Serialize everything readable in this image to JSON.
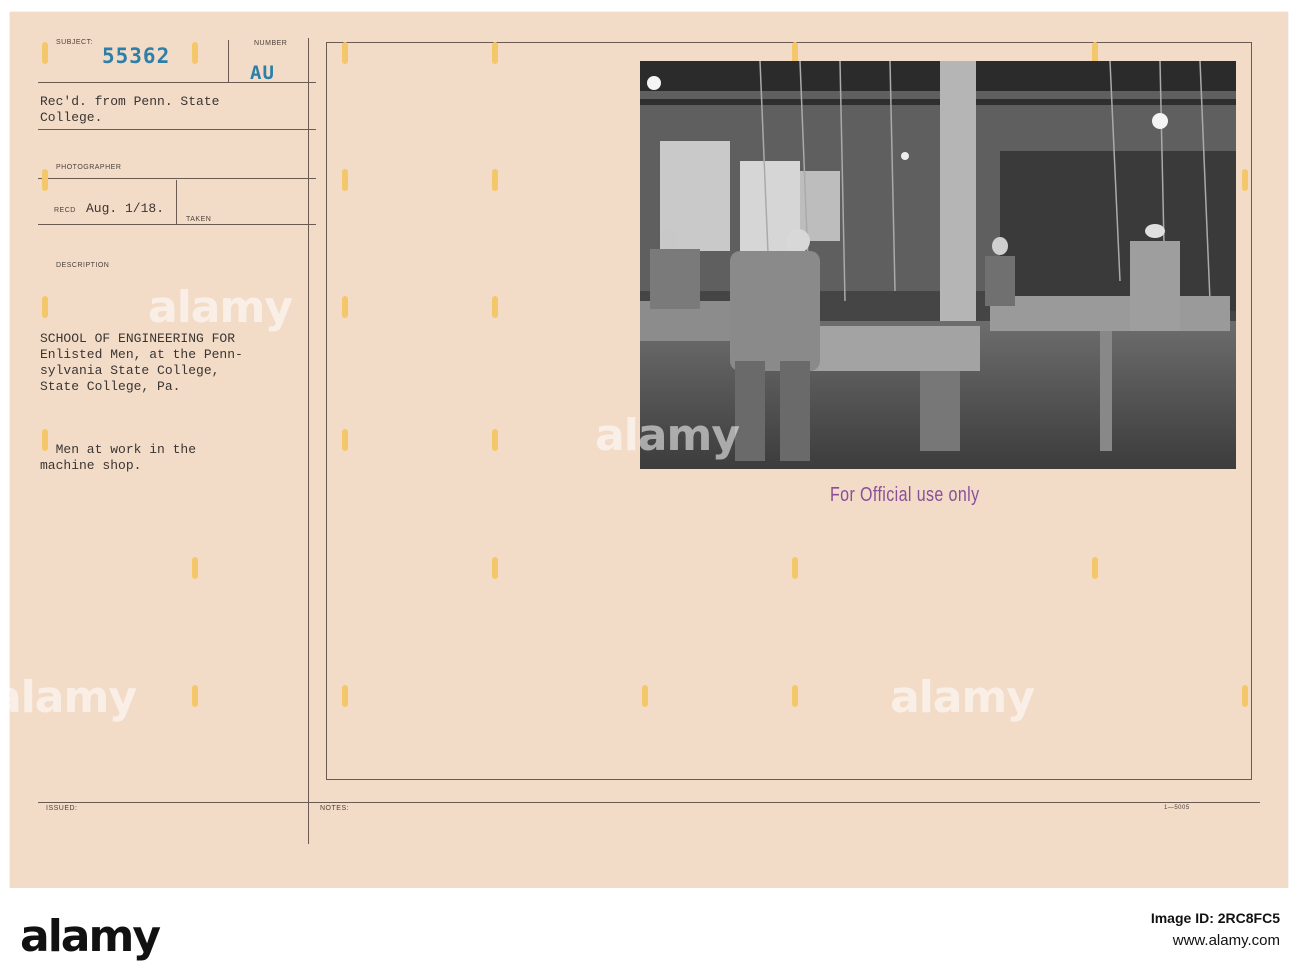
{
  "card": {
    "subject_label": "SUBJECT:",
    "subject_number": "55362",
    "number_label": "NUMBER",
    "number_value": "AU",
    "received_from": "Rec'd. from Penn. State\nCollege.",
    "photographer_label": "PHOTOGRAPHER",
    "recd_label": "RECD",
    "recd_date": "Aug. 1/18.",
    "taken_label": "TAKEN",
    "description_label": "DESCRIPTION",
    "description_main": "SCHOOL OF ENGINEERING FOR\nEnlisted Men, at the Penn-\nsylvania State College,\nState College, Pa.",
    "description_sub": "  Men at work in the\nmachine shop.",
    "issued_label": "ISSUED:",
    "notes_label": "NOTES:",
    "form_code": "1—5005",
    "stamp": "For Official use only"
  },
  "watermark": {
    "text": "alamy"
  },
  "bottom_bar": {
    "logo": "alamy",
    "image_id_line": "Image ID: 2RC8FC5",
    "website": "www.alamy.com"
  },
  "colors": {
    "card": "#f3dcc7",
    "accent_blue": "#2d7fa8",
    "stamp_purple": "#8a4f99",
    "rule": "#6b5a52"
  }
}
